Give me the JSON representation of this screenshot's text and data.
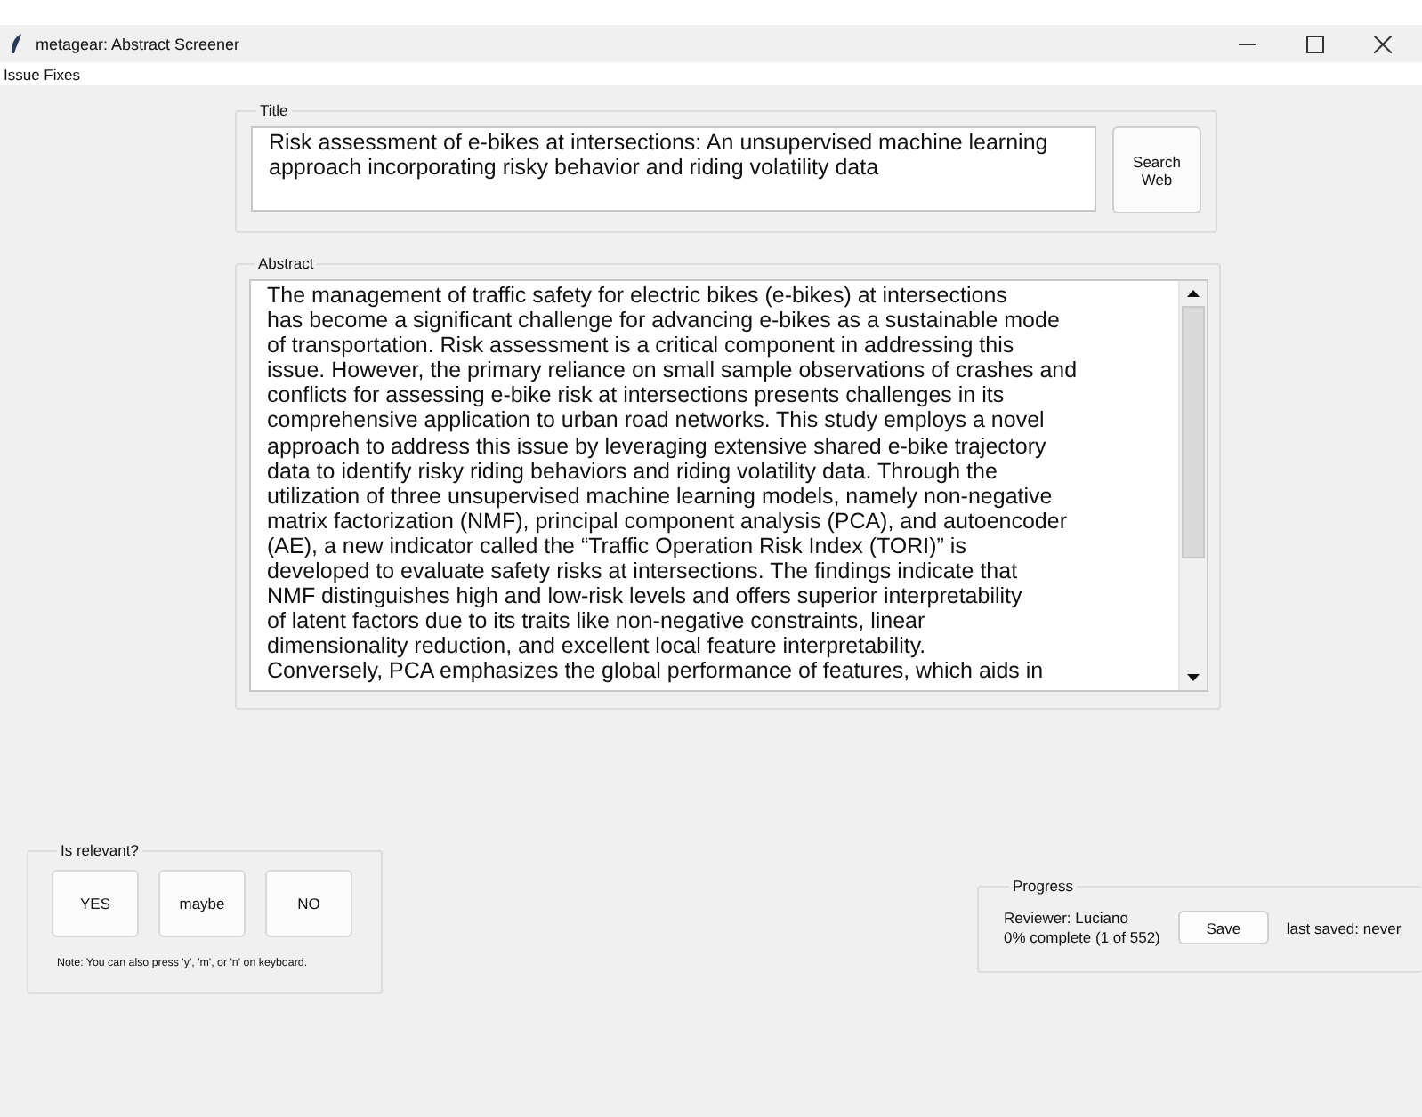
{
  "window": {
    "title": "metagear: Abstract Screener"
  },
  "menu": [
    "Issue Fixes"
  ],
  "title_group": {
    "label": "Title",
    "value": "Risk assessment of e-bikes at intersections: An unsupervised machine learning\napproach incorporating risky behavior and riding volatility data",
    "button": "Search\nWeb"
  },
  "abstract_group": {
    "label": "Abstract",
    "lines": [
      "The management of traffic safety for electric bikes (e-bikes) at intersections",
      "has become a significant challenge for advancing e-bikes as a sustainable mode",
      "of transportation. Risk assessment is a critical component in addressing this",
      "issue. However, the primary reliance on small sample observations of crashes and",
      "conflicts for assessing e-bike risk at intersections presents challenges in its",
      "comprehensive application to urban road networks. This study employs a novel",
      "approach to address this issue by leveraging extensive shared e-bike trajectory",
      "data to identify risky riding behaviors and riding volatility data. Through the",
      "utilization of three unsupervised machine learning models, namely non-negative",
      "matrix factorization (NMF), principal component analysis (PCA), and autoencoder",
      "(AE), a new indicator called the “Traffic Operation Risk Index (TORI)” is",
      "developed to evaluate safety risks at intersections. The findings indicate that",
      "NMF distinguishes high and low-risk levels and offers superior interpretability",
      "of latent factors due to its traits like non-negative constraints, linear",
      "dimensionality reduction, and excellent local feature interpretability.",
      "Conversely, PCA emphasizes the global performance of features, which aids in"
    ]
  },
  "relevance": {
    "label": "Is relevant?",
    "buttons": [
      "YES",
      "maybe",
      "NO"
    ],
    "note": "Note: You can also press 'y', 'm', or 'n' on keyboard."
  },
  "progress": {
    "label": "Progress",
    "reviewer": "Reviewer: Luciano",
    "complete": "0% complete (1 of 552)",
    "button": "Save",
    "last_saved": "last saved: never"
  }
}
